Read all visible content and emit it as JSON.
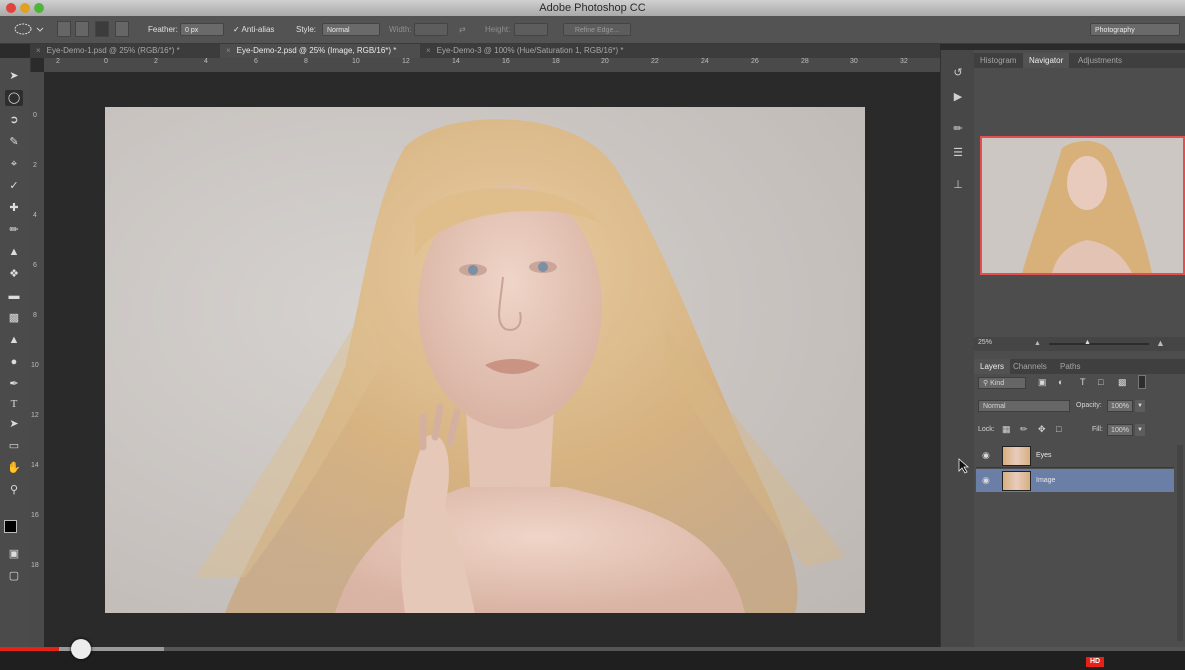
{
  "window": {
    "title": "Adobe Photoshop CC"
  },
  "options": {
    "feather_label": "Feather:",
    "feather_value": "0 px",
    "antialias_label": "Anti-alias",
    "style_label": "Style:",
    "style_value": "Normal",
    "width_label": "Width:",
    "height_label": "Height:",
    "refine_edge": "Refine Edge...",
    "workspace": "Photography"
  },
  "tabs": [
    {
      "label": "Eye-Demo-1.psd @ 25% (RGB/16*) *"
    },
    {
      "label": "Eye-Demo-2.psd @ 25% (Image, RGB/16*) *"
    },
    {
      "label": "Eye-Demo-3 @ 100% (Hue/Saturation 1, RGB/16*) *"
    }
  ],
  "ruler": {
    "ticks": [
      "2",
      "0",
      "2",
      "4",
      "6",
      "8",
      "10",
      "12",
      "14",
      "16",
      "18",
      "20",
      "22",
      "24",
      "26",
      "28",
      "30",
      "32"
    ],
    "vticks": [
      "0",
      "2",
      "4",
      "6",
      "8",
      "10",
      "12",
      "14",
      "16",
      "18"
    ]
  },
  "navigator_panel": {
    "tabs": [
      "Histogram",
      "Navigator",
      "Adjustments"
    ],
    "zoom": "25%"
  },
  "layers_panel": {
    "tabs": [
      "Layers",
      "Channels",
      "Paths"
    ],
    "filter_kind": "Kind",
    "blend_mode": "Normal",
    "opacity_label": "Opacity:",
    "opacity_value": "100%",
    "lock_label": "Lock:",
    "fill_label": "Fill:",
    "fill_value": "100%",
    "layers": [
      {
        "name": "Eyes",
        "selected": false
      },
      {
        "name": "Image",
        "selected": true
      }
    ]
  },
  "video": {
    "badge": "HD",
    "progress": 0.05
  },
  "colors": {
    "accent_layer_selected": "#6b7fa6",
    "nav_box": "#e05050",
    "yt_red": "#e62117"
  }
}
